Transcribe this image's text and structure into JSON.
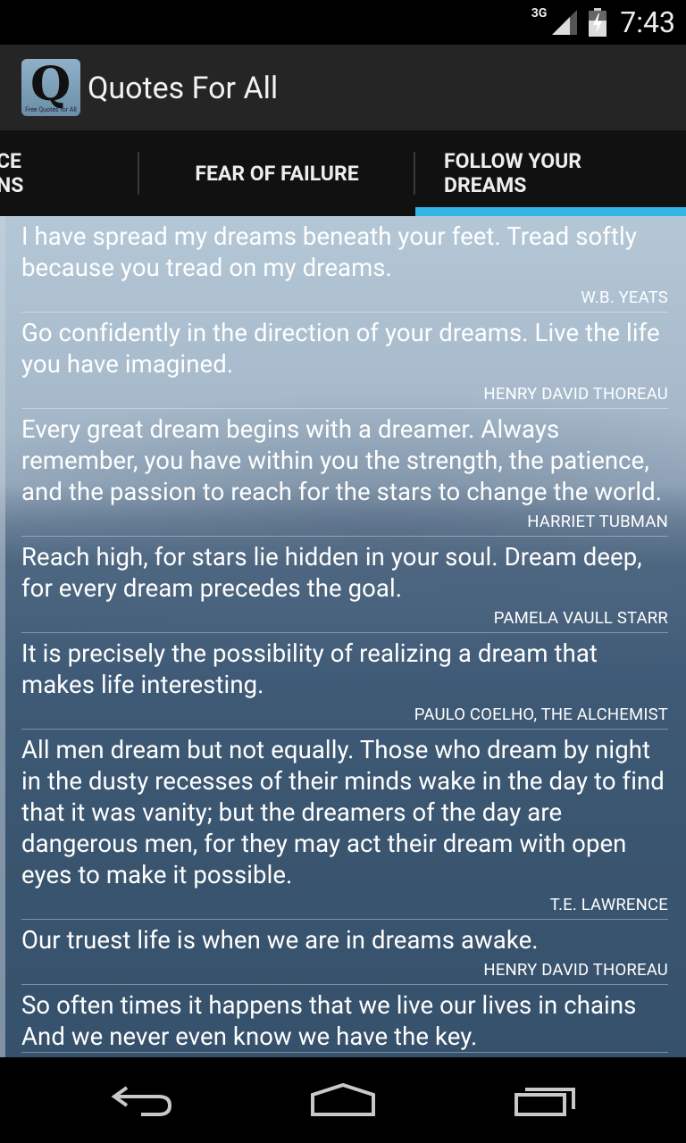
{
  "status": {
    "network": "3G",
    "time": "7:43"
  },
  "app": {
    "title": "Quotes For All",
    "icon_caption": "Free Quotes for All"
  },
  "tabs": [
    {
      "label": "CE\nNS"
    },
    {
      "label": "FEAR OF FAILURE"
    },
    {
      "label": "FOLLOW YOUR\nDREAMS",
      "selected": true
    }
  ],
  "colors": {
    "accent": "#33b5e5",
    "actionbar": "#252525"
  },
  "quotes": [
    {
      "text": "I have spread my dreams beneath your feet. Tread softly because you tread on my dreams.",
      "author": "W.B. YEATS"
    },
    {
      "text": "Go confidently in the direction of your dreams. Live the life you have imagined.",
      "author": "HENRY DAVID THOREAU"
    },
    {
      "text": "Every great dream begins with a dreamer. Always remember, you have within you the strength, the patience, and the passion to reach for the stars to change the world.",
      "author": "HARRIET TUBMAN"
    },
    {
      "text": "Reach high, for stars lie hidden in your soul. Dream deep, for every dream precedes the goal.",
      "author": "PAMELA VAULL STARR"
    },
    {
      "text": "It is precisely the possibility of realizing a dream that makes life interesting.",
      "author": "PAULO COELHO, THE ALCHEMIST"
    },
    {
      "text": "All men dream but not equally. Those who dream by night in the dusty recesses of their minds wake in the day to find that it was vanity; but the dreamers of the day are dangerous men, for they may act their dream with open eyes to make it possible.",
      "author": "T.E. LAWRENCE"
    },
    {
      "text": "Our truest life is when we are in dreams awake.",
      "author": "HENRY DAVID THOREAU"
    },
    {
      "text": "So often times it happens that we live our lives in chains And we never even know we have the key.",
      "author": ""
    }
  ],
  "nav": {
    "back_icon": "back-icon",
    "home_icon": "home-icon",
    "recents_icon": "recents-icon"
  }
}
